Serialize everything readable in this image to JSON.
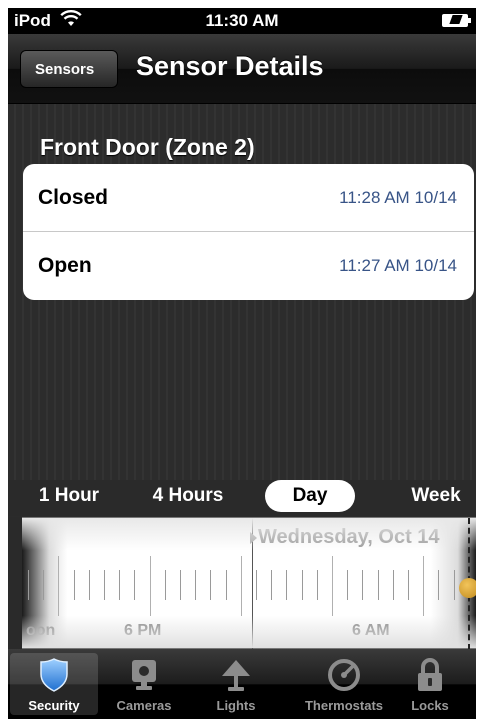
{
  "status_bar": {
    "device": "iPod",
    "time": "11:30 AM"
  },
  "nav": {
    "back_label": "Sensors",
    "title": "Sensor Details"
  },
  "sensor": {
    "name": "Front Door (Zone 2)",
    "events": [
      {
        "state": "Closed",
        "time": "11:28 AM 10/14"
      },
      {
        "state": "Open",
        "time": "11:27 AM 10/14"
      }
    ]
  },
  "range_options": [
    {
      "label": "1 Hour",
      "selected": false
    },
    {
      "label": "4 Hours",
      "selected": false
    },
    {
      "label": "Day",
      "selected": true
    },
    {
      "label": "Week",
      "selected": false
    }
  ],
  "timeline": {
    "day_label": "Wednesday, Oct 14",
    "time_labels": [
      "oon",
      "6 PM",
      "6 AM"
    ]
  },
  "tabs": [
    {
      "label": "Security",
      "icon": "shield-icon",
      "active": true
    },
    {
      "label": "Cameras",
      "icon": "camera-icon",
      "active": false
    },
    {
      "label": "Lights",
      "icon": "lamp-icon",
      "active": false
    },
    {
      "label": "Thermostats",
      "icon": "thermostat-icon",
      "active": false
    },
    {
      "label": "Locks",
      "icon": "lock-icon",
      "active": false
    }
  ],
  "colors": {
    "time_text": "#385487",
    "accent_knob": "#d9a33a",
    "shield": "#3d8fe0"
  }
}
